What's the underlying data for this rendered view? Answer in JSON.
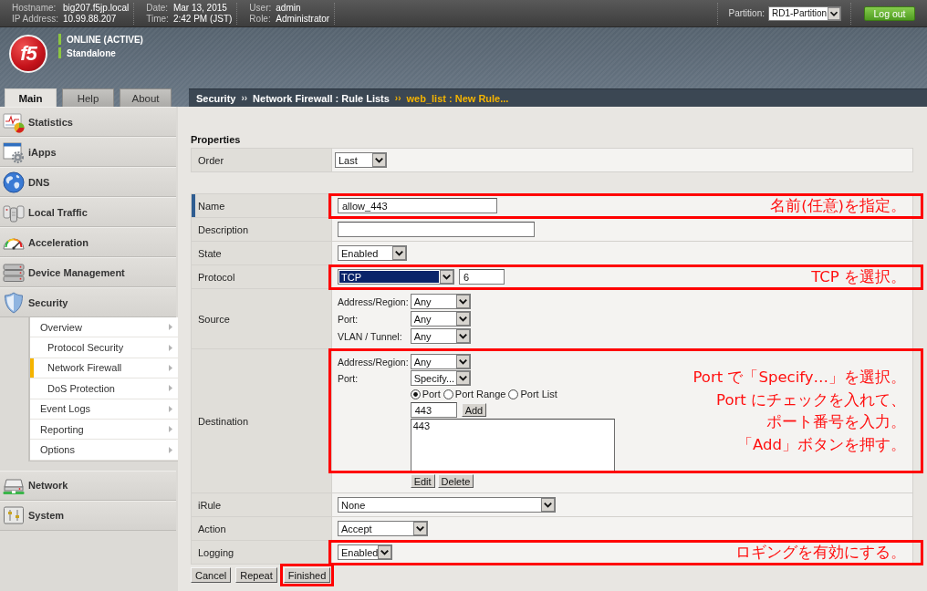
{
  "top_bar": {
    "info_groups": [
      {
        "rows": [
          {
            "label": "Hostname:",
            "value": "big207.f5jp.local"
          },
          {
            "label": "IP Address:",
            "value": "10.99.88.207"
          }
        ]
      },
      {
        "rows": [
          {
            "label": "Date:",
            "value": "Mar 13, 2015"
          },
          {
            "label": "Time:",
            "value": "2:42 PM (JST)"
          }
        ]
      },
      {
        "rows": [
          {
            "label": "User:",
            "value": "admin"
          },
          {
            "label": "Role:",
            "value": "Administrator"
          }
        ]
      }
    ],
    "partition": {
      "label": "Partition:",
      "value": "RD1-Partition"
    },
    "logout_button": "Log out"
  },
  "header": {
    "logo": "f5",
    "status": [
      {
        "label": "ONLINE (ACTIVE)"
      },
      {
        "label": "Standalone"
      }
    ]
  },
  "tabs": [
    {
      "label": "Main",
      "selected": true
    },
    {
      "label": "Help",
      "selected": false
    },
    {
      "label": "About",
      "selected": false
    }
  ],
  "breadcrumb": {
    "items": [
      {
        "label": "Security",
        "current": false
      },
      {
        "separator": "››",
        "label": "Network Firewall : Rule Lists",
        "current": false
      },
      {
        "separator": "››",
        "label": "web_list : New Rule...",
        "current": true
      }
    ]
  },
  "sidebar": {
    "items": [
      {
        "label": "Statistics"
      },
      {
        "label": "iApps"
      },
      {
        "label": "DNS"
      },
      {
        "label": "Local Traffic"
      },
      {
        "label": "Acceleration"
      },
      {
        "label": "Device Management"
      },
      {
        "label": "Security",
        "children": [
          {
            "label": "Overview",
            "selected": false,
            "children": [
              {
                "label": "Protocol Security",
                "selected": false
              },
              {
                "label": "Network Firewall",
                "selected": true
              },
              {
                "label": "DoS Protection",
                "selected": false
              }
            ]
          },
          {
            "label": "Event Logs",
            "selected": false
          },
          {
            "label": "Reporting",
            "selected": false
          },
          {
            "label": "Options",
            "selected": false
          }
        ]
      },
      {
        "label": "Network"
      },
      {
        "label": "System"
      }
    ]
  },
  "rule_form": {
    "heading": "Properties",
    "order": {
      "label": "Order",
      "value": "Last"
    },
    "rows": [
      {
        "kind": "text",
        "label": "Name",
        "required": true,
        "value": "allow_443",
        "note": {
          "lines": [
            "名前(任意)を指定。"
          ]
        }
      },
      {
        "kind": "text",
        "label": "Description",
        "required": false
      },
      {
        "kind": "select",
        "label": "State",
        "required": false,
        "value": "Enabled"
      },
      {
        "kind": "protocol",
        "label": "Protocol",
        "required": false,
        "value": "TCP",
        "focused": true,
        "number": "6",
        "note": {
          "lines": [
            "TCP を選択。"
          ]
        }
      },
      {
        "kind": "group",
        "label": "Source",
        "required": false,
        "fields": [
          {
            "label": "Address/Region:",
            "value": "Any"
          },
          {
            "label": "Port:",
            "value": "Any"
          },
          {
            "label": "VLAN / Tunnel:",
            "value": "Any"
          }
        ]
      },
      {
        "kind": "destination",
        "label": "Destination",
        "required": false,
        "fields": [
          {
            "label": "Address/Region:",
            "value": "Any"
          },
          {
            "label": "Port:",
            "value": "Specify..."
          }
        ],
        "port_types": [
          {
            "label": "Port",
            "selected": true
          },
          {
            "label": "Port Range",
            "selected": false
          },
          {
            "label": "Port List",
            "selected": false
          }
        ],
        "port_value": "443",
        "add_button": "Add",
        "port_list": [
          "443"
        ],
        "list_buttons": [
          "Edit",
          "Delete"
        ],
        "note": {
          "lines": [
            "Port で「Specify…」を選択。",
            "Port にチェックを入れて、",
            "ポート番号を入力。",
            "「Add」ボタンを押す。"
          ]
        }
      },
      {
        "kind": "select",
        "label": "iRule",
        "required": false,
        "value": "None"
      },
      {
        "kind": "select",
        "label": "Action",
        "required": false,
        "value": "Accept"
      },
      {
        "kind": "select",
        "label": "Logging",
        "required": false,
        "value": "Enabled",
        "note": {
          "lines": [
            "ロギングを有効にする。"
          ]
        }
      }
    ],
    "buttons": [
      {
        "label": "Cancel",
        "highlighted": false
      },
      {
        "label": "Repeat",
        "highlighted": false
      },
      {
        "label": "Finished",
        "highlighted": true
      }
    ]
  }
}
